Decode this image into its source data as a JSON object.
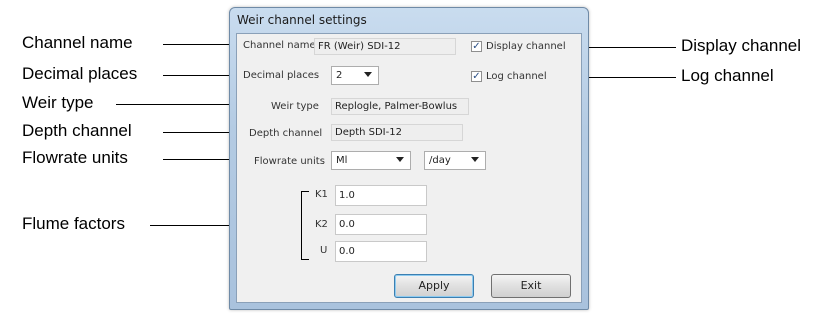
{
  "callouts": {
    "channel_name": "Channel name",
    "decimal_places": "Decimal places",
    "weir_type": "Weir type",
    "depth_channel": "Depth channel",
    "flowrate_units": "Flowrate units",
    "flume_factors": "Flume factors",
    "display_channel": "Display channel",
    "log_channel": "Log channel"
  },
  "dialog": {
    "title": "Weir channel settings",
    "channel_name": {
      "label": "Channel name",
      "value": "FR (Weir) SDI-12"
    },
    "decimal_places": {
      "label": "Decimal places",
      "value": "2"
    },
    "display_channel": {
      "label": "Display channel",
      "checked": true
    },
    "log_channel": {
      "label": "Log channel",
      "checked": true
    },
    "weir_type": {
      "label": "Weir type",
      "value": "Replogle, Palmer-Bowlus"
    },
    "depth_channel": {
      "label": "Depth channel",
      "value": "Depth SDI-12"
    },
    "flowrate_units": {
      "label": "Flowrate units",
      "unit": "Ml",
      "per": "/day"
    },
    "factors": [
      {
        "label": "K1",
        "value": "1.0"
      },
      {
        "label": "K2",
        "value": "0.0"
      },
      {
        "label": "U",
        "value": "0.0"
      }
    ],
    "apply_label": "Apply",
    "exit_label": "Exit"
  },
  "icons": {
    "check": "checkmark-icon",
    "dropdown": "chevron-down-icon"
  }
}
